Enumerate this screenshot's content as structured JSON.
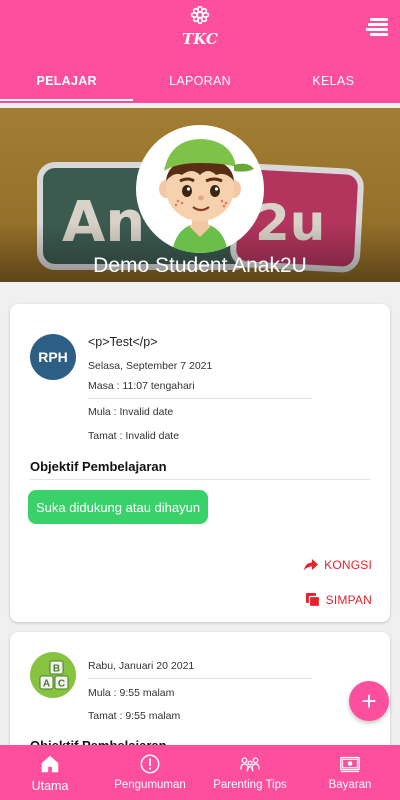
{
  "header": {
    "logo_text": "TKC",
    "menu_icon": "hamburger-menu-icon"
  },
  "tabs": [
    {
      "label": "PELAJAR",
      "active": true
    },
    {
      "label": "LAPORAN",
      "active": false
    },
    {
      "label": "KELAS",
      "active": false
    }
  ],
  "profile": {
    "name": "Demo Student Anak2U",
    "banner_text": "Anak2u"
  },
  "cards": [
    {
      "badge": "RPH",
      "title": "<p>Test</p>",
      "date": "Selasa, September 7 2021",
      "time": "Masa : 11:07 tengahari",
      "start": "Mula : Invalid date",
      "end": "Tamat : Invalid date",
      "objective_heading": "Objektif Pembelajaran",
      "objective_chip": "Suka didukung atau dihayun",
      "share_label": "KONGSI",
      "save_label": "SIMPAN"
    },
    {
      "badge_icon": "abc-blocks-icon",
      "date": "Rabu, Januari 20 2021",
      "start": "Mula : 9:55 malam",
      "end": "Tamat : 9:55 malam",
      "objective_heading": "Objektif Pembelajaran"
    }
  ],
  "fab": {
    "label": "+"
  },
  "bottom_nav": [
    {
      "label": "Utama",
      "icon": "home-icon"
    },
    {
      "label": "Pengumuman",
      "icon": "alert-circle-icon"
    },
    {
      "label": "Parenting Tips",
      "icon": "family-icon"
    },
    {
      "label": "Bayaran",
      "icon": "cash-icon"
    }
  ],
  "colors": {
    "primary": "#fd4f9e",
    "badge_blue": "#2d5f85",
    "chip_green": "#39d16a",
    "action_red": "#e8212c",
    "abc_green": "#86c43f"
  }
}
